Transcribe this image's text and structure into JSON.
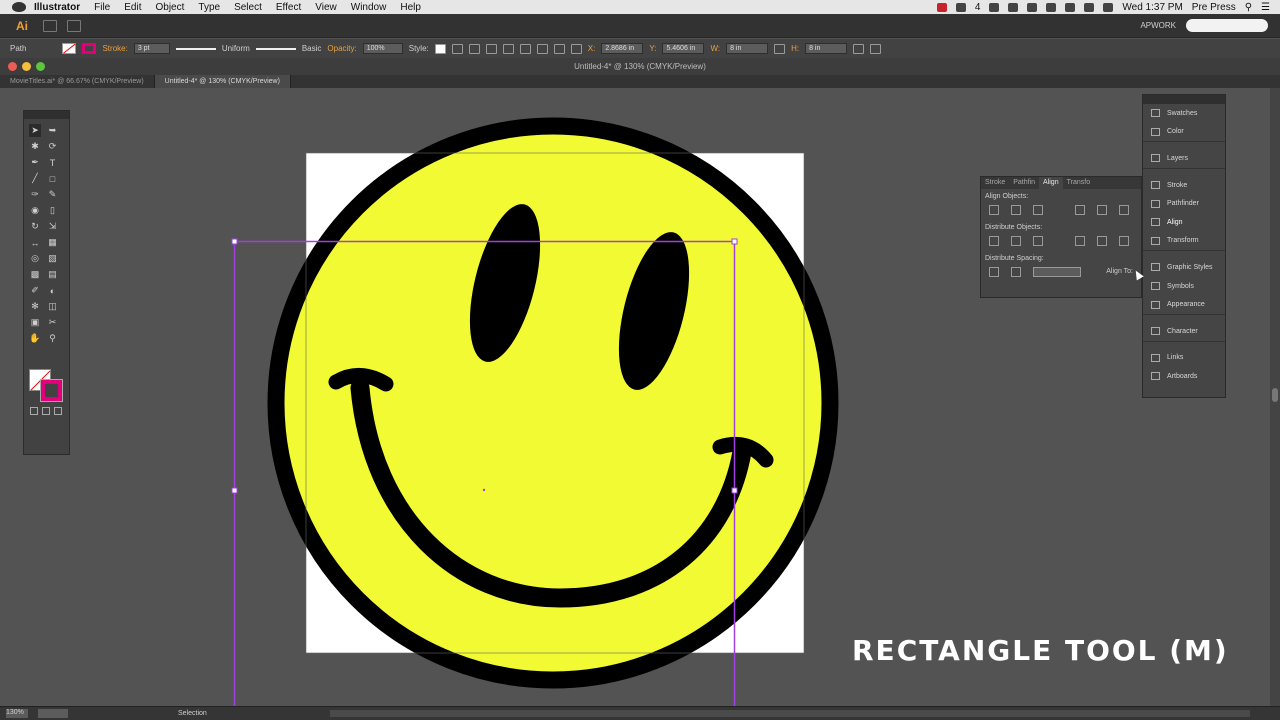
{
  "menubar": {
    "app": "Illustrator",
    "items": [
      "File",
      "Edit",
      "Object",
      "Type",
      "Select",
      "Effect",
      "View",
      "Window",
      "Help"
    ],
    "clock": "Wed 1:37 PM",
    "user": "Pre Press",
    "status_num": "4"
  },
  "appbar": {
    "logo": "Ai",
    "workspace": "APWORK"
  },
  "control": {
    "selection_type": "Path",
    "stroke_label": "Stroke:",
    "stroke_weight": "3 pt",
    "profile": "Uniform",
    "brush": "Basic",
    "opacity_label": "Opacity:",
    "opacity": "100%",
    "style_label": "Style:",
    "x_label": "X:",
    "x": "2.8686 in",
    "y_label": "Y:",
    "y": "5.4606 in",
    "w_label": "W:",
    "w": "8 in",
    "h_label": "H:",
    "h": "8 in"
  },
  "window_title": "Untitled-4* @ 130% (CMYK/Preview)",
  "tabs": [
    "MovieTitles.ai* @ 66.67% (CMYK/Preview)",
    "Untitled-4* @ 130% (CMYK/Preview)"
  ],
  "align_panel": {
    "tabs": [
      "Stroke",
      "Pathfin",
      "Align",
      "Transfo"
    ],
    "align_objects": "Align Objects:",
    "distribute_objects": "Distribute Objects:",
    "distribute_spacing": "Distribute Spacing:",
    "align_to": "Align To:"
  },
  "dock": {
    "groups": [
      [
        "Swatches",
        "Color"
      ],
      [
        "Layers"
      ],
      [
        "Stroke",
        "Pathfinder",
        "Align",
        "Transform"
      ],
      [
        "Graphic Styles",
        "Symbols",
        "Appearance"
      ],
      [
        "Character"
      ],
      [
        "Links",
        "Artboards"
      ]
    ]
  },
  "status": {
    "zoom": "130%",
    "tool": "Selection"
  },
  "caption": "RECTANGLE TOOL (M)",
  "colors": {
    "face": "#f2fa34",
    "outline": "#000000",
    "selection": "#a040e0",
    "stroke_swatch": "#e0007a"
  }
}
